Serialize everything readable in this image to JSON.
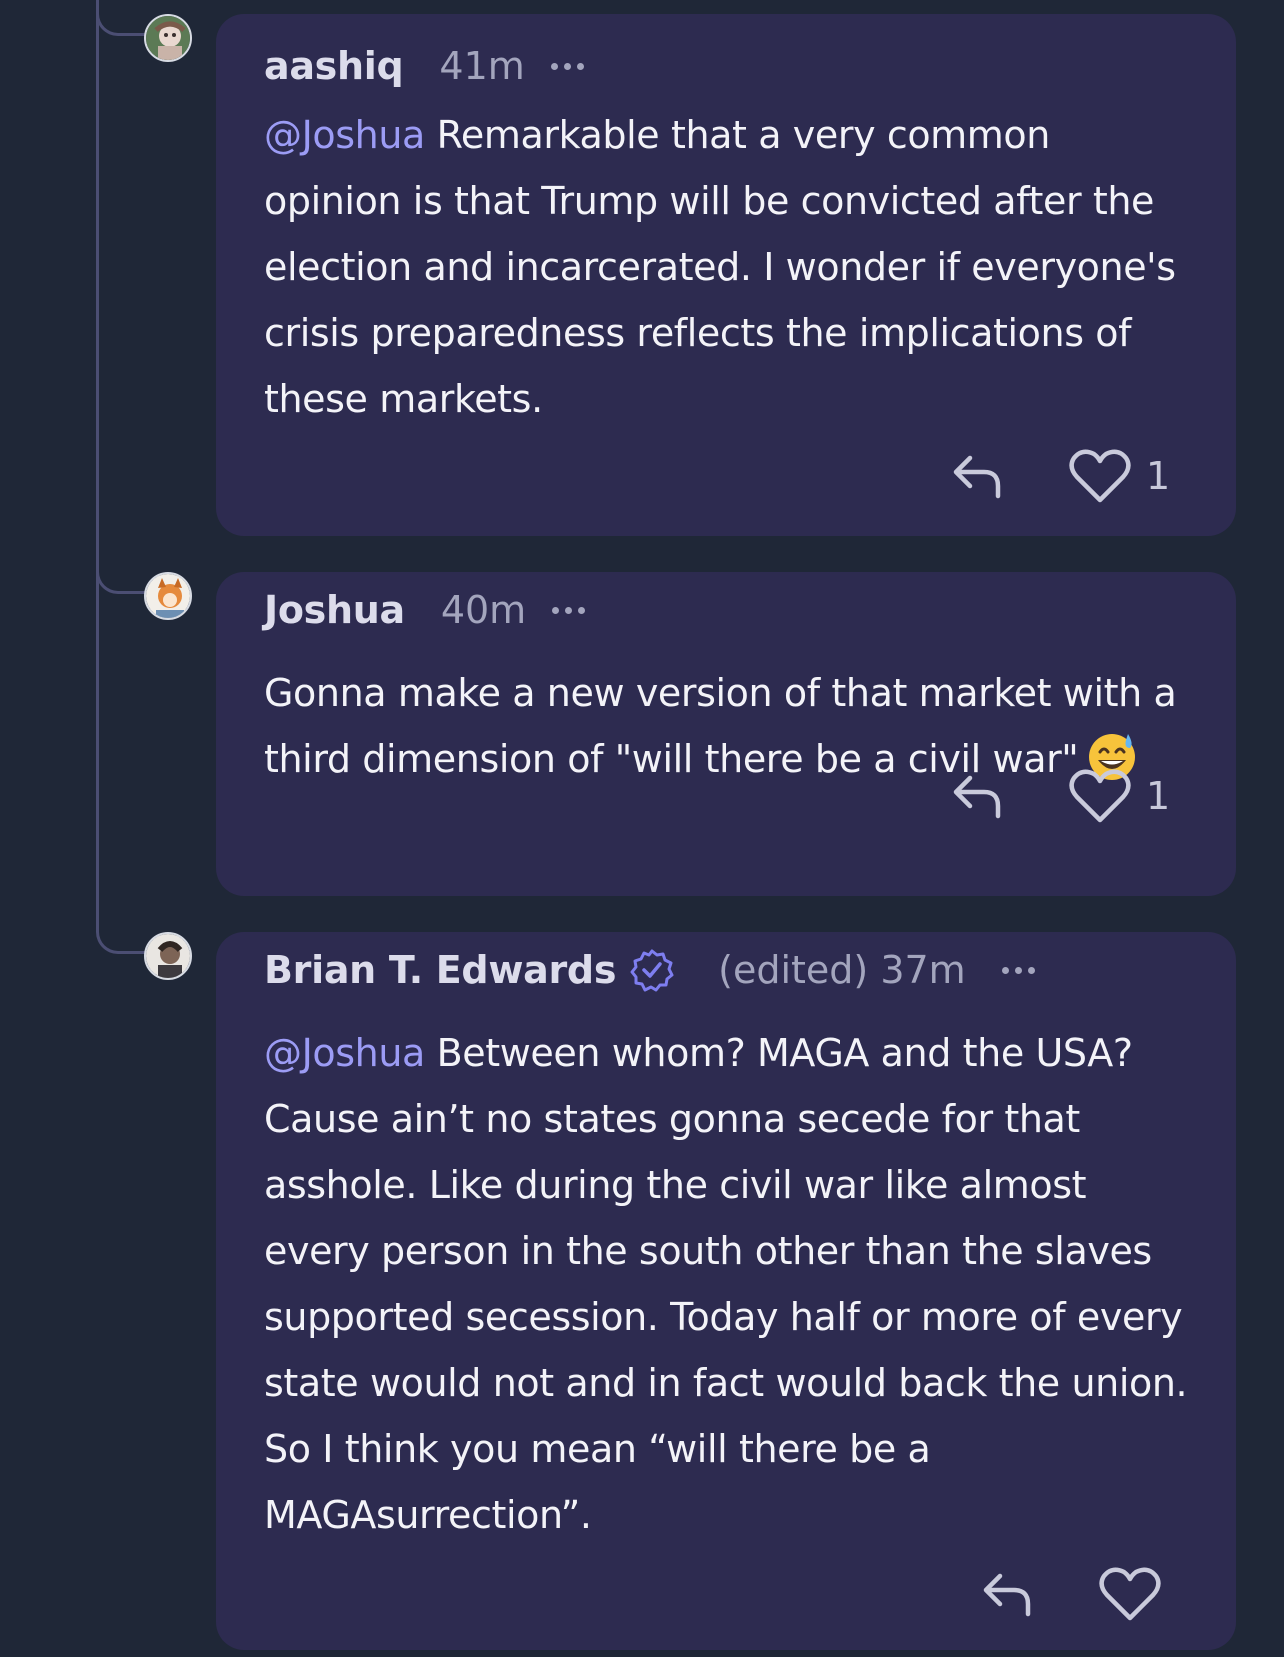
{
  "colors": {
    "background": "#1f2737",
    "card": "#2d2b50",
    "mention": "#9c9cf5",
    "verified": "#7e7ef0",
    "thread_line": "#4b4e73"
  },
  "comments": [
    {
      "author": "aashiq",
      "time": "41m",
      "mention": "@Joshua",
      "text": " Remarkable that a very common opinion is that Trump will be convicted after the election and incarcerated. I wonder if everyone's crisis preparedness reflects the implications of these markets.",
      "likes": "1",
      "avatar_icon": "avatar-aashiq"
    },
    {
      "author": "Joshua",
      "time": "40m",
      "text": "Gonna make a new version of that market with a third dimension of \"will there be a civil war\"",
      "emoji": "grinning-sweat-emoji",
      "likes": "1",
      "avatar_icon": "avatar-joshua"
    },
    {
      "author": "Brian T. Edwards",
      "verified": true,
      "time": "(edited) 37m",
      "mention": "@Joshua",
      "text": " Between whom? MAGA and the USA? Cause ain’t no states gonna secede for that asshole. Like during the civil war like almost every person in the south other than the slaves supported secession. Today half or more of every state would not and in fact would back the union. So I think you mean “will there be a MAGAsurrection”.",
      "avatar_icon": "avatar-brian"
    }
  ],
  "icons": {
    "reply": "reply-icon",
    "like": "heart-icon",
    "more": "more-icon",
    "verified": "verified-badge-icon"
  }
}
